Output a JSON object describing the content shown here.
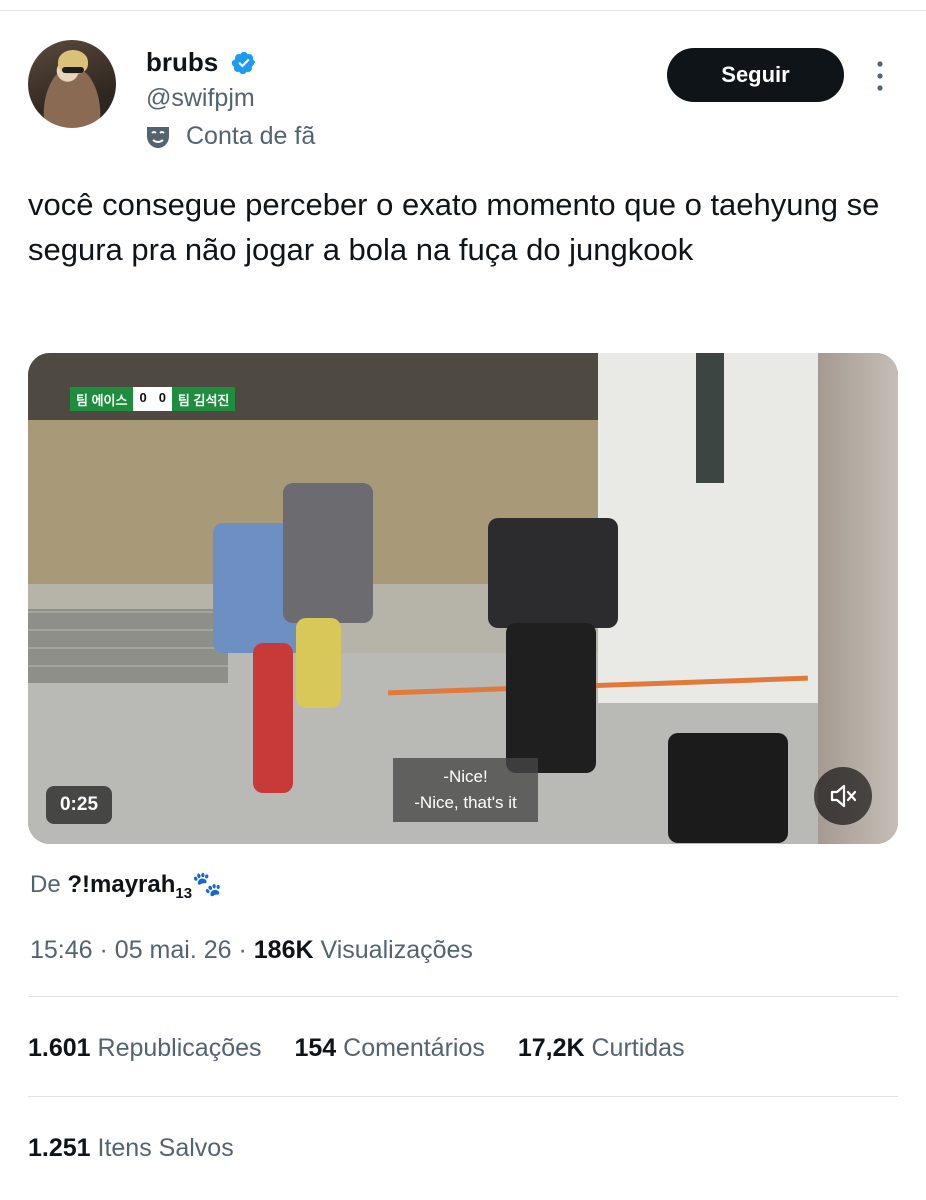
{
  "author": {
    "name": "brubs",
    "handle": "@swifpjm",
    "label": "Conta de fã",
    "verified_color": "#1d9bf0"
  },
  "follow_button": {
    "label": "Seguir"
  },
  "tweet": {
    "text": "você consegue perceber o exato momento que o taehyung se segura pra não jogar a bola na fuça do jungkook"
  },
  "video": {
    "scoreboard": {
      "team_left": "팀 에이스",
      "score_left": "0",
      "score_right": "0",
      "team_right": "팀 김석진"
    },
    "subtitle_line1": "-Nice!",
    "subtitle_line2": "-Nice, that's it",
    "timecode": "0:25",
    "mute_icon": "speaker-muted-icon"
  },
  "source": {
    "prefix": "De",
    "name": "?!mayrah",
    "name_sub": "13",
    "emoji": "🐾"
  },
  "meta": {
    "time": "15:46",
    "date": "05 mai. 26",
    "separator": "·",
    "views_count": "186K",
    "views_label": "Visualizações"
  },
  "stats": [
    {
      "count": "1.601",
      "label": "Republicações"
    },
    {
      "count": "154",
      "label": "Comentários"
    },
    {
      "count": "17,2K",
      "label": "Curtidas"
    }
  ],
  "saved": {
    "count": "1.251",
    "label": "Itens Salvos"
  }
}
